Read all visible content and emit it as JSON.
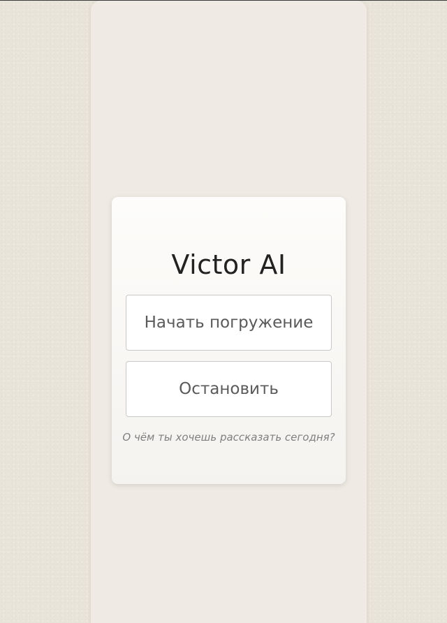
{
  "app": {
    "title": "Victor AI"
  },
  "actions": {
    "start_label": "Начать погружение",
    "stop_label": "Остановить"
  },
  "prompt": {
    "text": "О чём ты хочешь рассказать сегодня?"
  },
  "colors": {
    "background": "#e9e4d9",
    "panel": "#efebe4",
    "card": "#fdfcfa",
    "title_text": "#222222",
    "button_text": "#5a5a5a",
    "prompt_text": "#7f7f7f"
  }
}
